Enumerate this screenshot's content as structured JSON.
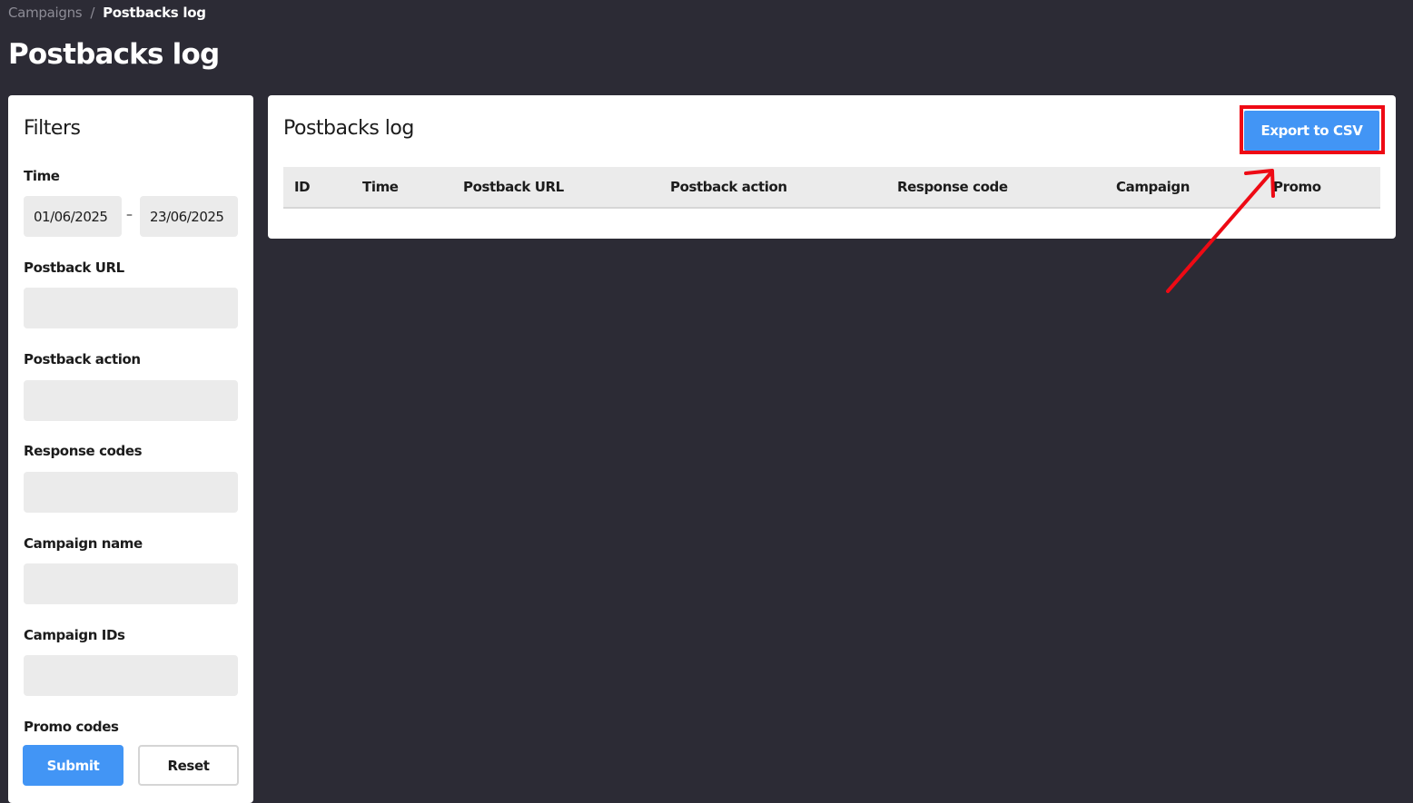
{
  "breadcrumb": {
    "parent": "Campaigns",
    "separator": "/",
    "current": "Postbacks log"
  },
  "page_title": "Postbacks log",
  "filters": {
    "title": "Filters",
    "time_label": "Time",
    "date_from": "01/06/2025",
    "date_separator": "–",
    "date_to": "23/06/2025",
    "postback_url_label": "Postback URL",
    "postback_url_value": "",
    "postback_action_label": "Postback action",
    "postback_action_value": "",
    "response_codes_label": "Response codes",
    "response_codes_value": "",
    "campaign_name_label": "Campaign name",
    "campaign_name_value": "",
    "campaign_ids_label": "Campaign IDs",
    "campaign_ids_value": "",
    "promo_codes_label": "Promo codes",
    "submit_label": "Submit",
    "reset_label": "Reset"
  },
  "main": {
    "title": "Postbacks log",
    "export_label": "Export to CSV",
    "columns": [
      "ID",
      "Time",
      "Postback URL",
      "Postback action",
      "Response code",
      "Campaign",
      "Promo"
    ]
  },
  "colors": {
    "background": "#2c2b35",
    "panel": "#ffffff",
    "accent": "#4295f5",
    "input_bg": "#ebebeb",
    "annotation_red": "#ee0a14"
  }
}
